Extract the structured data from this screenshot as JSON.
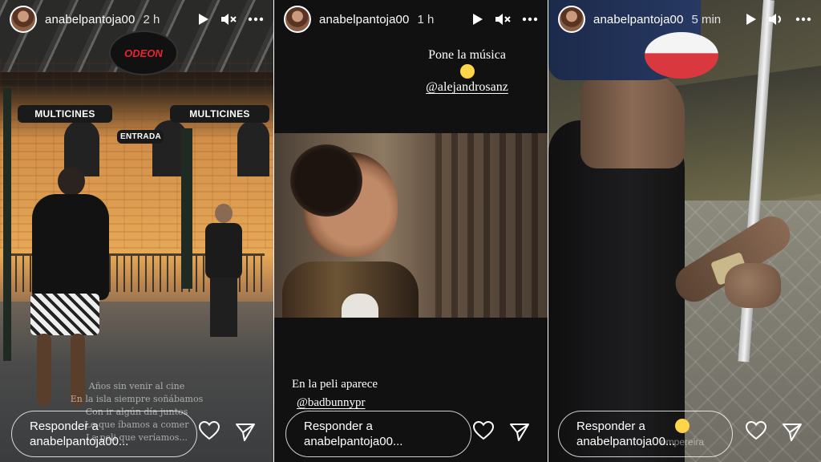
{
  "stories": [
    {
      "username": "anabelpantoja00",
      "time": "2 h",
      "signs": {
        "neon": "ODEON",
        "left": "MULTICINES",
        "right": "MULTICINES",
        "entrance": "ENTRADA"
      },
      "overlay_lines": [
        "Años sin venir al cine",
        "En la isla siempre soñábamos",
        "Con ir algún día juntos",
        "Lo que íbamos a comer",
        "La peli que veríamos..."
      ],
      "reply_line1": "Responder a",
      "reply_line2": "anabelpantoja00..."
    },
    {
      "username": "anabelpantoja00",
      "time": "1 h",
      "caption_top": "Pone la música",
      "mention_top": "@alejandrosanz",
      "caption_bottom": "En la peli aparece",
      "mention_bottom": "@badbunnypr",
      "reply_line1": "Responder a",
      "reply_line2": "anabelpantoja00..."
    },
    {
      "username": "anabelpantoja00",
      "time": "5 min",
      "reply_line1": "Responder a",
      "reply_line2": "anabelpantoja00...",
      "overlay_tag": "ompereira"
    }
  ],
  "icons": {
    "play": "play-icon",
    "mute": "speaker-muted-icon",
    "sound": "speaker-icon",
    "more": "more-dots-icon",
    "heart": "heart-icon",
    "send": "send-icon"
  }
}
